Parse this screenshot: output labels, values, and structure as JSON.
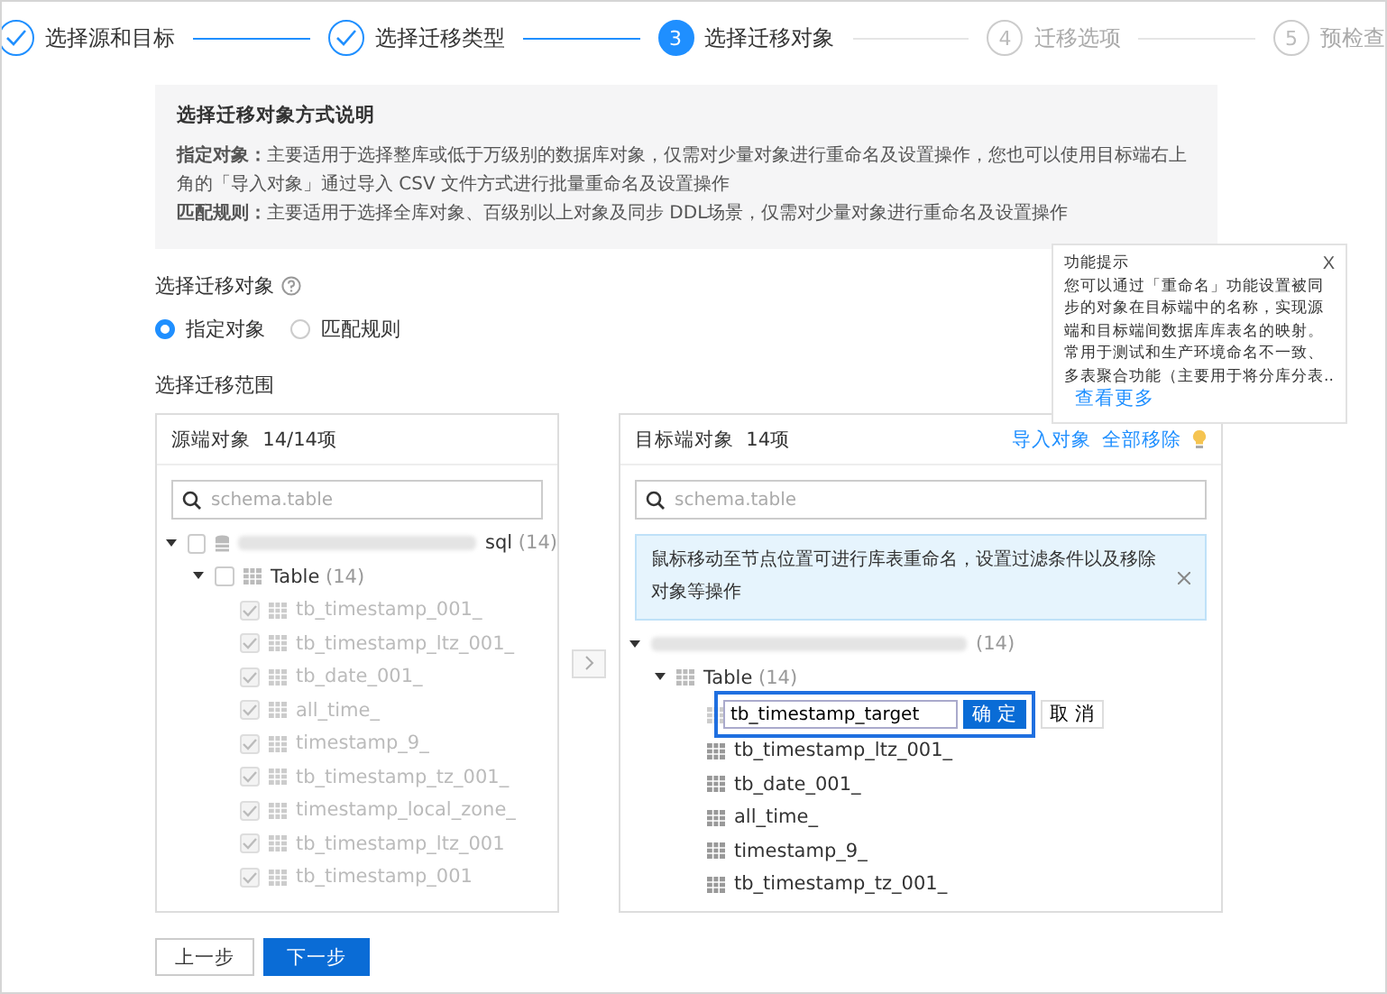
{
  "steps": [
    {
      "label": "选择源和目标",
      "done": true,
      "selected": false
    },
    {
      "label": "选择迁移类型",
      "done": true,
      "selected": false
    },
    {
      "number": "3",
      "label": "选择迁移对象",
      "done": false,
      "selected": true
    },
    {
      "number": "4",
      "label": "迁移选项",
      "done": false,
      "selected": false
    },
    {
      "number": "5",
      "label": "预检查",
      "done": false,
      "selected": false
    }
  ],
  "info": {
    "title": "选择迁移对象方式说明",
    "paragraphs": [
      "**指定对象：**主要适用于选择整库或低于万级别的数据库对象，仅需对少量对象进行重命名及设置操作，您也可以使用目标端右上角的「导入对象」通过导入 CSV 文件方式进行批量重命名及设置操作",
      "**匹配规则：**主要适用于选择全库对象、百级别以上对象及同步 DDL场景，仅需对少量对象进行重命名及设置操作"
    ]
  },
  "mode": {
    "label": "选择迁移对象",
    "options": [
      {
        "label": "指定对象",
        "selected": true
      },
      {
        "label": "匹配规则",
        "selected": false
      }
    ]
  },
  "scope_label": "选择迁移范围",
  "source": {
    "title": "源端对象",
    "count": "14/14项",
    "search_placeholder": "schema.table",
    "database": {
      "name_tail": "sql",
      "count": "(14)",
      "checked": false,
      "expanded": true
    },
    "group": {
      "label": "Table",
      "count": "(14)",
      "checked": false,
      "expanded": true
    },
    "tables": [
      {
        "name": "tb_timestamp_001_",
        "checked": true,
        "disabled": true
      },
      {
        "name": "tb_timestamp_ltz_001_",
        "checked": true,
        "disabled": true
      },
      {
        "name": "tb_date_001_",
        "checked": true,
        "disabled": true
      },
      {
        "name": "all_time_",
        "checked": true,
        "disabled": true
      },
      {
        "name": "timestamp_9_",
        "checked": true,
        "disabled": true
      },
      {
        "name": "tb_timestamp_tz_001_",
        "checked": true,
        "disabled": true
      },
      {
        "name": "timestamp_local_zone_",
        "checked": true,
        "disabled": true
      },
      {
        "name": "tb_timestamp_ltz_001",
        "checked": true,
        "disabled": true
      },
      {
        "name": "tb_timestamp_001",
        "checked": true,
        "disabled": true
      }
    ]
  },
  "target": {
    "title": "目标端对象",
    "count": "14项",
    "actions": [
      "导入对象",
      "全部移除"
    ],
    "search_placeholder": "schema.table",
    "notice": "鼠标移动至节点位置可进行库表重命名，设置过滤条件以及移除对象等操作",
    "database": {
      "count": "(14)",
      "expanded": true
    },
    "group": {
      "label": "Table",
      "count": "(14)",
      "expanded": true
    },
    "rename": {
      "value": "tb_timestamp_target",
      "confirm": "确 定",
      "cancel": "取 消"
    },
    "tables": [
      "tb_timestamp_ltz_001_",
      "tb_date_001_",
      "all_time_",
      "timestamp_9_",
      "tb_timestamp_tz_001_"
    ]
  },
  "tooltip": {
    "title": "功能提示",
    "body": "您可以通过「重命名」功能设置被同步的对象在目标端中的名称，实现源端和目标端间数据库库表名的映射。常用于测试和生产环境命名不一致、多表聚合功能（主要用于将分库分表..",
    "link": "查看更多",
    "close": "X"
  },
  "buttons": {
    "prev": "上一步",
    "next": "下一步"
  }
}
